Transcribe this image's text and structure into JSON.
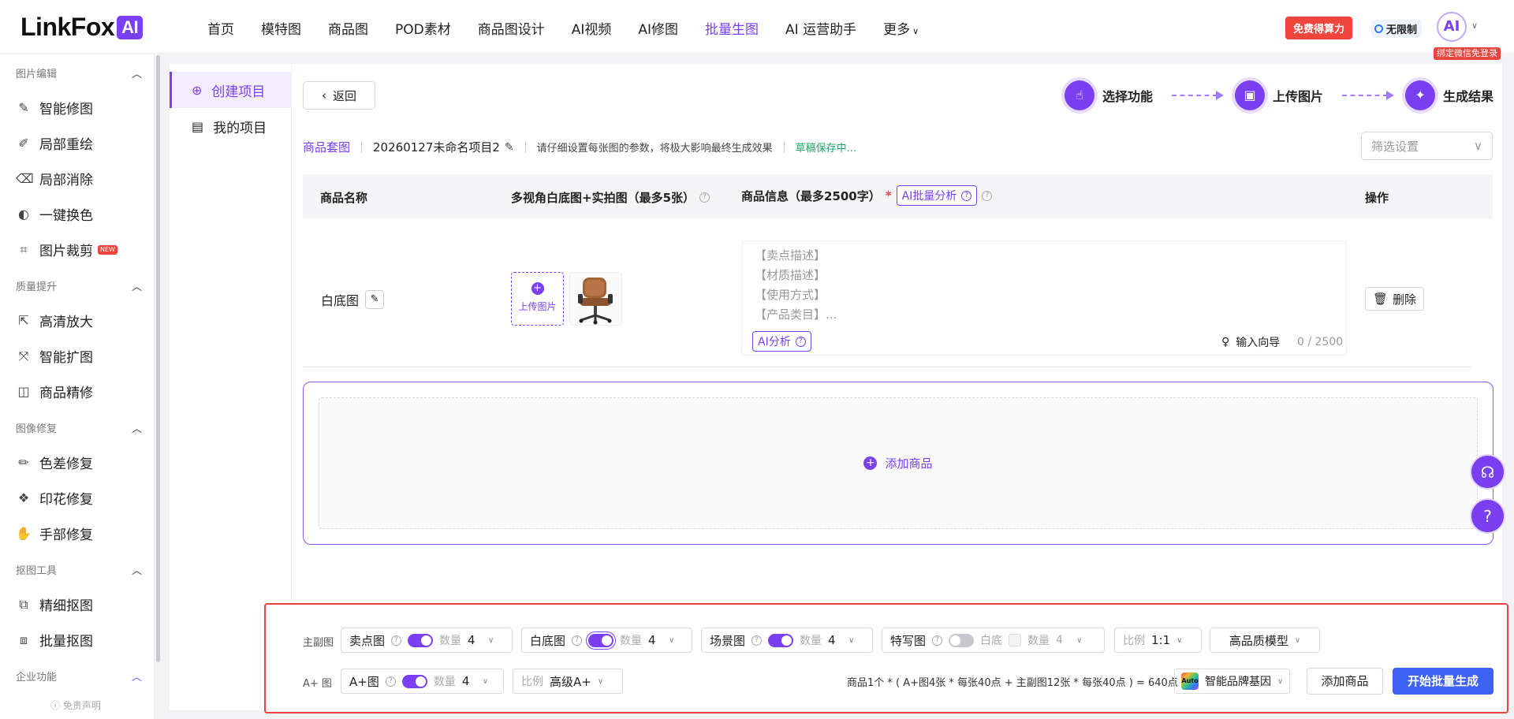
{
  "header": {
    "logo_text": "LinkFox",
    "logo_badge": "AI",
    "nav": [
      "首页",
      "模特图",
      "商品图",
      "POD素材",
      "商品图设计",
      "AI视频",
      "AI修图",
      "批量生图",
      "AI 运营助手",
      "更多"
    ],
    "active_nav": "批量生图",
    "free_compute": "免费得算力",
    "unlimited": "无限制",
    "avatar": "AI",
    "bind_wechat": "绑定微信免登录"
  },
  "sidebar": {
    "sections": [
      {
        "title": "图片编辑",
        "items": [
          "智能修图",
          "局部重绘",
          "局部消除",
          "一键换色",
          "图片裁剪"
        ]
      },
      {
        "title": "质量提升",
        "items": [
          "高清放大",
          "智能扩图",
          "商品精修"
        ]
      },
      {
        "title": "图像修复",
        "items": [
          "色差修复",
          "印花修复",
          "手部修复"
        ]
      },
      {
        "title": "抠图工具",
        "items": [
          "精细抠图",
          "批量抠图"
        ]
      },
      {
        "title": "企业功能",
        "items": []
      }
    ],
    "new_badge": "NEW",
    "disclaimer": "ⓘ 免责声明"
  },
  "projects": {
    "create": "创建项目",
    "mine": "我的项目"
  },
  "main": {
    "back": "返回",
    "steps": [
      "选择功能",
      "上传图片",
      "生成结果"
    ],
    "crumb_link": "商品套图",
    "project_name": "20260127未命名项目2",
    "hint": "请仔细设置每张图的参数，将极大影响最终生成效果",
    "saving": "草稿保存中...",
    "filter_placeholder": "筛选设置",
    "table": {
      "col_name": "商品名称",
      "col_images": "多视角白底图+实拍图（最多5张）",
      "col_info": "商品信息（最多2500字）",
      "ai_batch": "AI批量分析",
      "col_ops": "操作"
    },
    "row": {
      "name": "白底图",
      "upload": "上传图片",
      "placeholders": [
        "【卖点描述】",
        "【材质描述】",
        "【使用方式】",
        "【产品类目】..."
      ],
      "ai_analyze": "AI分析",
      "guide": "输入向导",
      "count": "0 / 2500",
      "delete": "删除"
    },
    "add_product": "添加商品"
  },
  "bottom": {
    "main_label": "主副图",
    "aplus_label": "A+ 图",
    "qty_label": "数量",
    "ratio_label": "比例",
    "items": {
      "selling": {
        "name": "卖点图",
        "on": true,
        "qty": "4"
      },
      "white": {
        "name": "白底图",
        "on": true,
        "qty": "4"
      },
      "scene": {
        "name": "场景图",
        "on": true,
        "qty": "4"
      },
      "closeup": {
        "name": "特写图",
        "on": false,
        "qty": "4",
        "sub": "白底"
      },
      "ratio": "1:1",
      "model": "高品质模型",
      "aplus": {
        "name": "A+图",
        "on": true,
        "qty": "4"
      },
      "aplus_ratio": "高级A+"
    },
    "formula": "商品1个 * ( A+图4张 * 每张40点 + 主副图12张 * 每张40点 ) = 640点",
    "brand_badge": "Auto",
    "brand": "智能品牌基因",
    "add_product": "添加商品",
    "start": "开始批量生成"
  }
}
